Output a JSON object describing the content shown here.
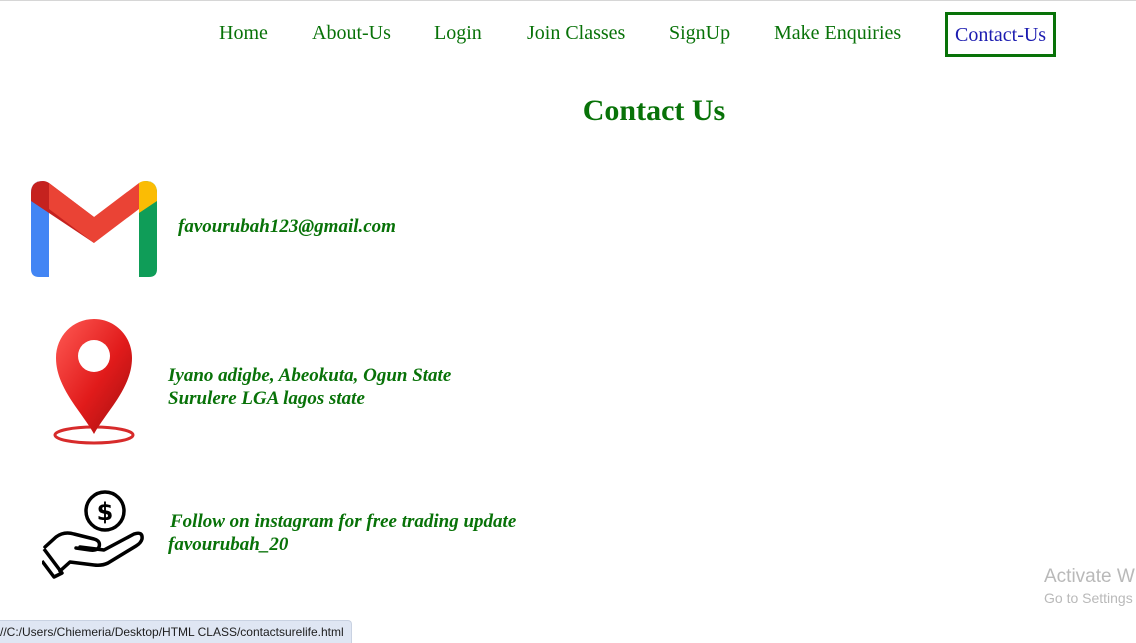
{
  "nav": {
    "items": [
      {
        "label": "Home"
      },
      {
        "label": "About-Us"
      },
      {
        "label": "Login"
      },
      {
        "label": "Join Classes"
      },
      {
        "label": "SignUp"
      },
      {
        "label": "Make Enquiries"
      },
      {
        "label": "Contact-Us"
      }
    ],
    "active_color": "#1b1bb0",
    "color": "#087208"
  },
  "page": {
    "title": "Contact Us"
  },
  "contacts": {
    "email": {
      "icon": "gmail-icon",
      "text": "favourubah123@gmail.com"
    },
    "location": {
      "icon": "location-pin-icon",
      "line1": "Iyano adigbe, Abeokuta, Ogun State",
      "line2": "Surulere LGA lagos state"
    },
    "instagram": {
      "icon": "money-hand-icon",
      "line1": "Follow on instagram for free trading update",
      "line2": "favourubah_20"
    }
  },
  "watermark": {
    "title": "Activate W",
    "subtitle": "Go to Settings"
  },
  "status_bar": {
    "url": "//C:/Users/Chiemeria/Desktop/HTML CLASS/contactsurelife.html"
  },
  "colors": {
    "accent_green": "#087208",
    "link_blue": "#1b1bb0"
  }
}
